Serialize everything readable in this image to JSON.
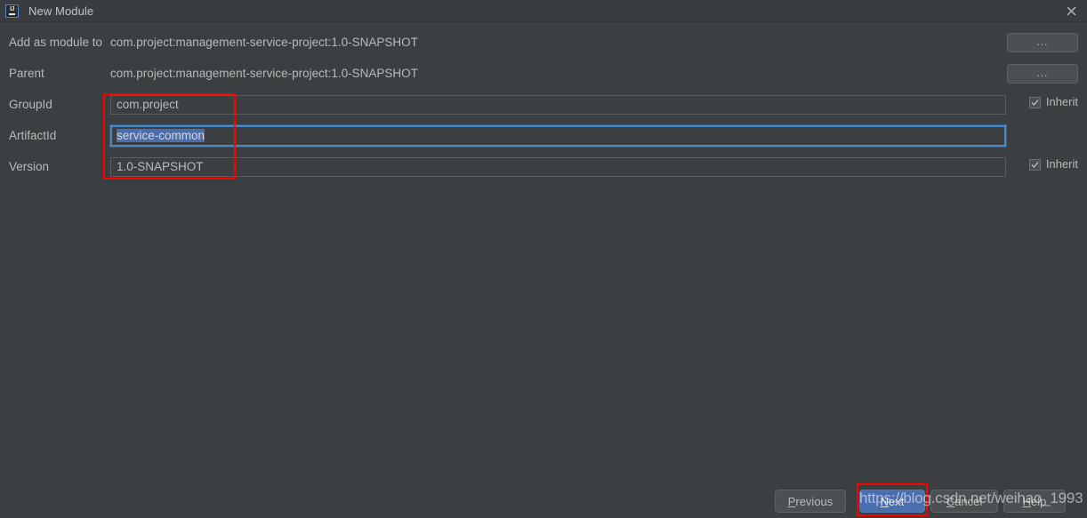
{
  "window": {
    "title": "New Module",
    "icon": "intellij-idea-icon",
    "icon_text": "IJ",
    "close_icon": "close-icon",
    "bg_color": "#3c3f41",
    "titlebar_color": "#3a3d3f",
    "accent_color": "#4b6eaf",
    "annotation_color": "#ff0000"
  },
  "form": {
    "rows": [
      {
        "label": "Add as module to",
        "type": "static",
        "value": "com.project:management-service-project:1.0-SNAPSHOT",
        "button": "..."
      },
      {
        "label": "Parent",
        "type": "static",
        "value": "com.project:management-service-project:1.0-SNAPSHOT",
        "button": "..."
      },
      {
        "label": "GroupId",
        "type": "input",
        "value": "com.project",
        "focused": false,
        "inherit_label": "Inherit",
        "inherit_checked": true
      },
      {
        "label": "ArtifactId",
        "type": "input",
        "value": "service-common",
        "focused": true,
        "selected": true,
        "inherit_label": "",
        "inherit_checked": false
      },
      {
        "label": "Version",
        "type": "input",
        "value": "1.0-SNAPSHOT",
        "focused": false,
        "inherit_label": "Inherit",
        "inherit_checked": true
      }
    ]
  },
  "footer": {
    "previous_label": "Previous",
    "previous_mnemonic": "P",
    "previous_rest": "revious",
    "next_label": "Next",
    "next_mnemonic": "N",
    "next_rest": "ext",
    "cancel_label": "Cancel",
    "cancel_mnemonic": "C",
    "cancel_rest": "ancel",
    "help_label": "Help",
    "help_mnemonic": "H",
    "help_rest": "elp"
  },
  "watermark": {
    "text": "https://blog.csdn.net/weihao_1993"
  }
}
